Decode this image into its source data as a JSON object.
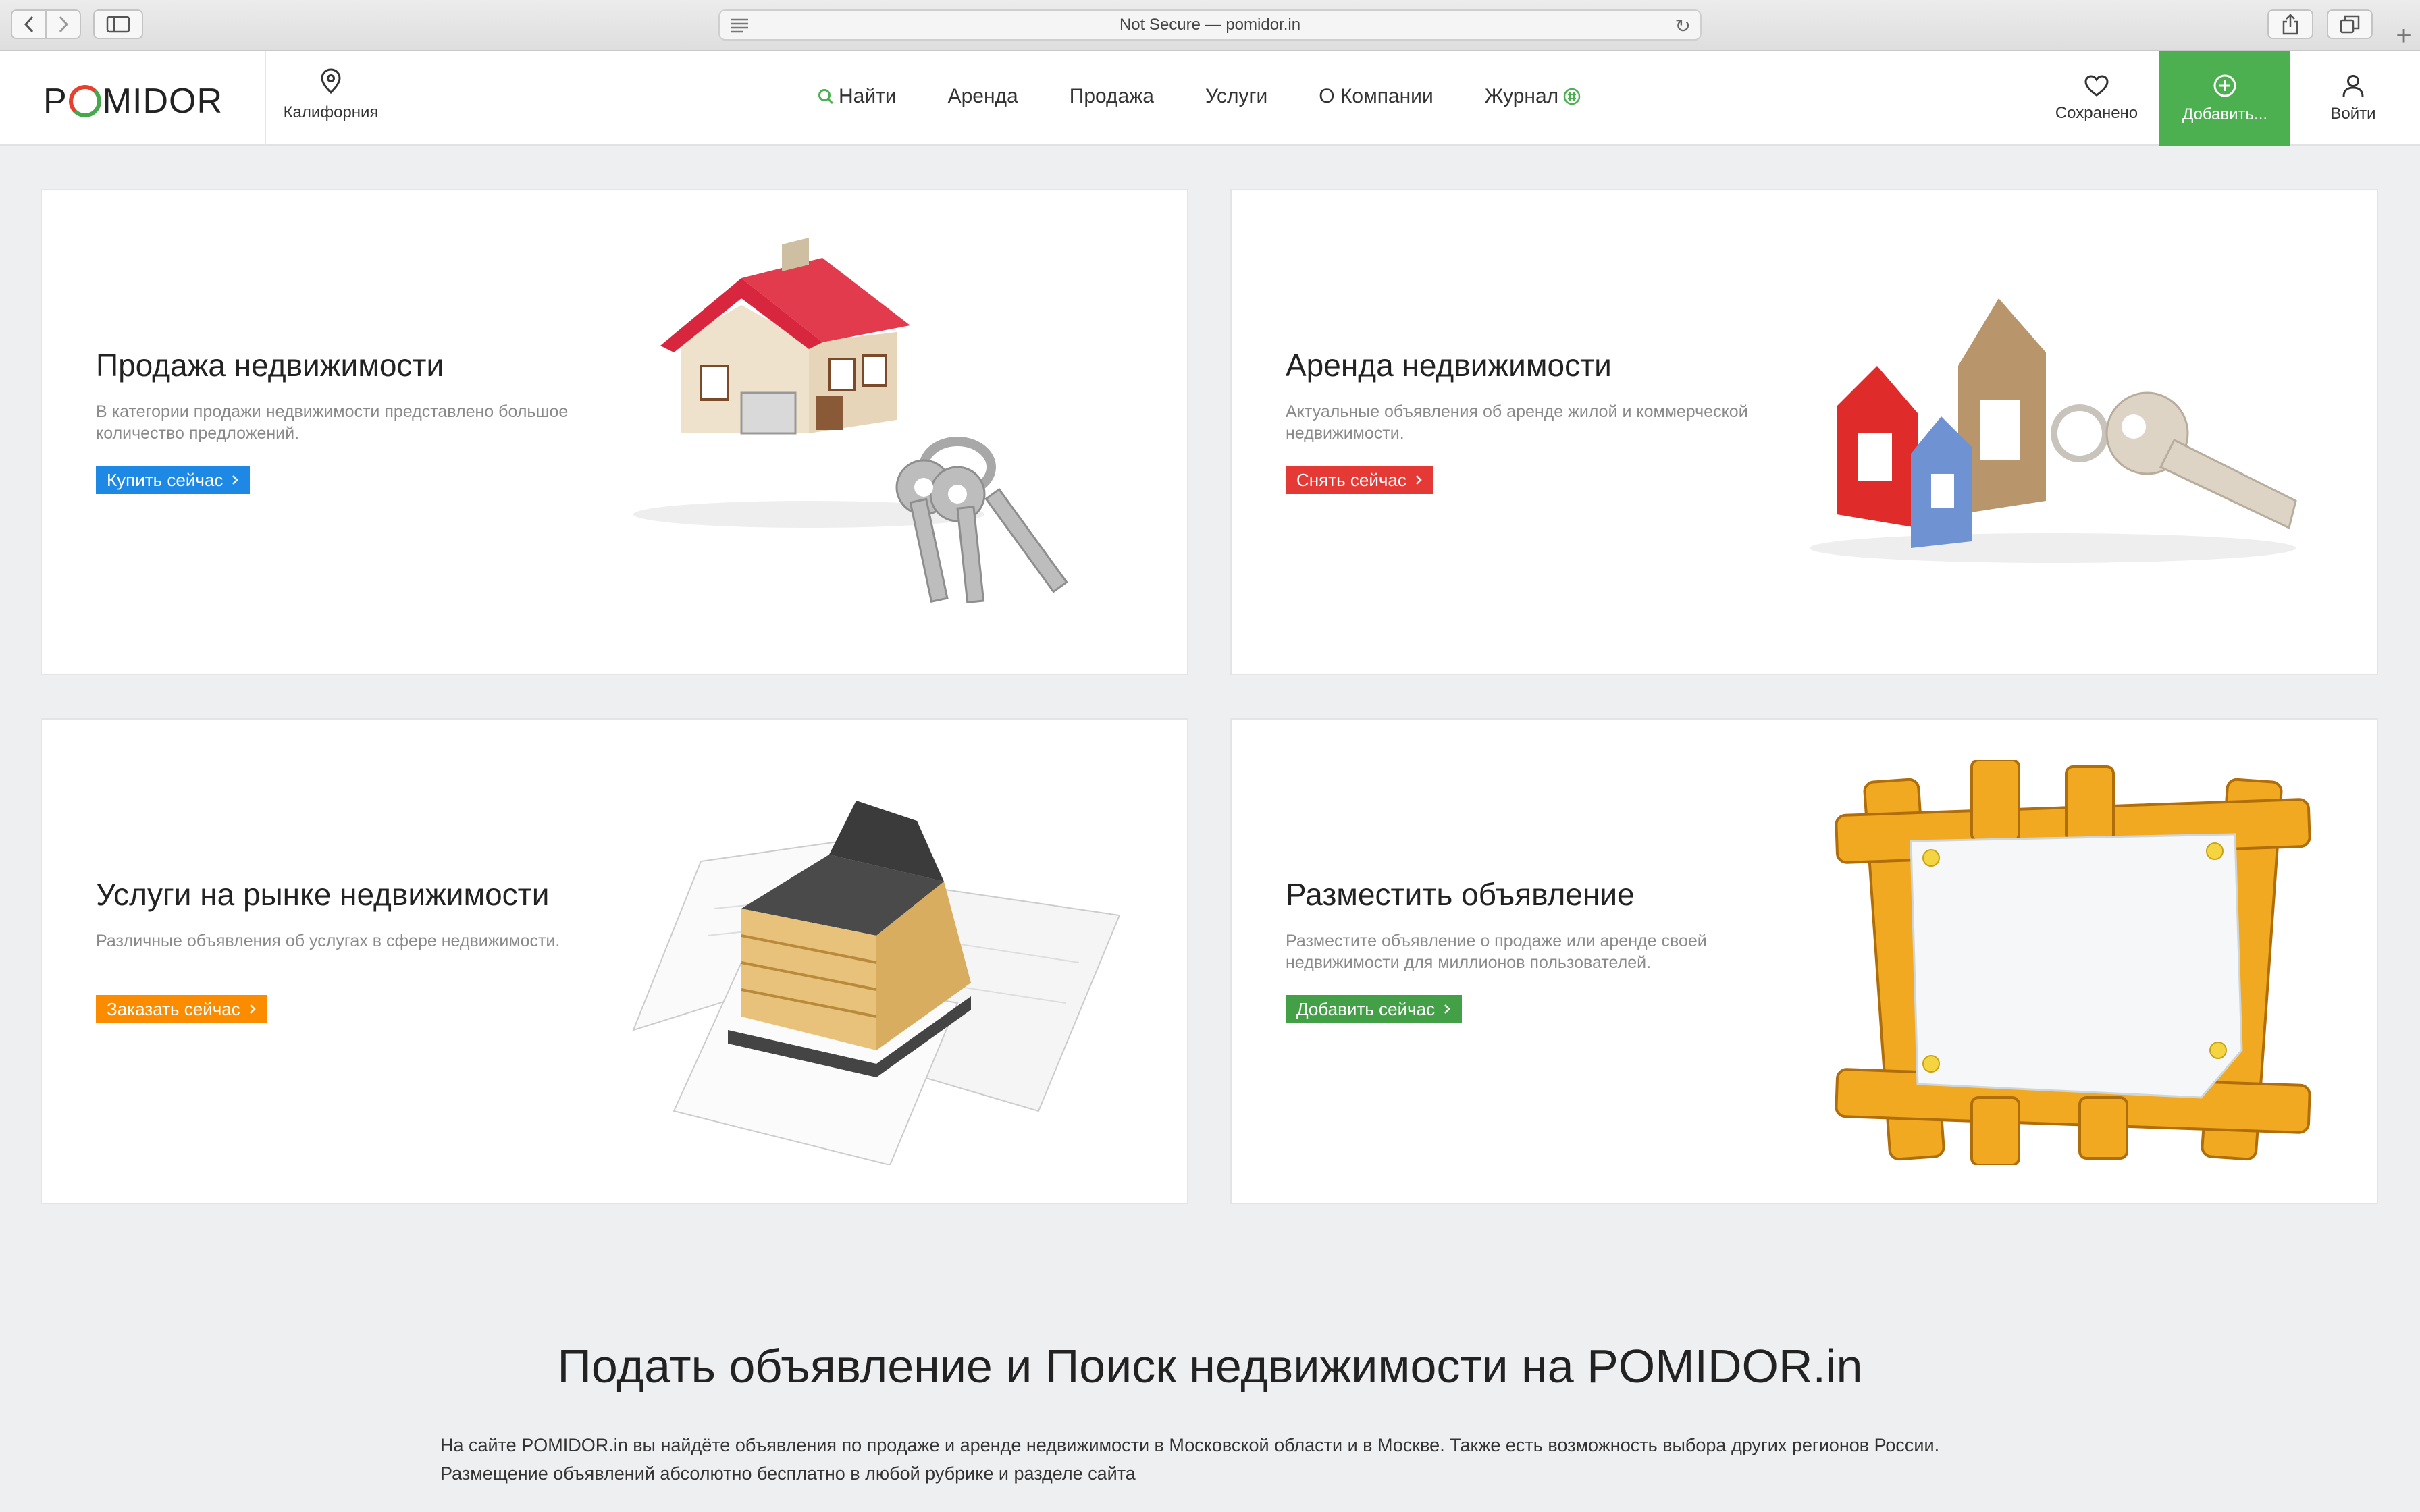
{
  "browser": {
    "address": "Not Secure — pomidor.in"
  },
  "header": {
    "logo_left": "P",
    "logo_right": "MIDOR",
    "location": "Калифорния",
    "nav": [
      {
        "label": "Найти"
      },
      {
        "label": "Аренда"
      },
      {
        "label": "Продажа"
      },
      {
        "label": "Услуги"
      },
      {
        "label": "О Компании"
      },
      {
        "label": "Журнал"
      }
    ],
    "saved": "Сохранено",
    "add": "Добавить...",
    "login": "Войти"
  },
  "cards": [
    {
      "title": "Продажа недвижимости",
      "desc": "В категории продажи недвижимости представлено большое количество предложений.",
      "button": "Купить сейчас"
    },
    {
      "title": "Аренда недвижимости",
      "desc": "Актуальные объявления об аренде жилой и коммерческой недвижимости.",
      "button": "Снять сейчас"
    },
    {
      "title": "Услуги на рынке недвижимости",
      "desc": "Различные объявления об услугах в сфере недвижимости.",
      "button": "Заказать сейчас"
    },
    {
      "title": "Разместить объявление",
      "desc": "Разместите объявление о продаже или аренде своей недвижимости для миллионов пользователей.",
      "button": "Добавить сейчас"
    }
  ],
  "bottom": {
    "title": "Подать объявление и Поиск недвижимости на POMIDOR.in",
    "text": "На сайте POMIDOR.in вы найдёте объявления по продаже и аренде недвижимости в Московской области и в Москве. Также есть возможность выбора других регионов России. Размещение объявлений абсолютно бесплатно в любой рубрике и разделе сайта"
  },
  "colors": {
    "accent_green": "#4caf50",
    "blue": "#1e88e5",
    "red": "#e53935",
    "orange": "#fb8c00",
    "green": "#43a047"
  },
  "icons": [
    "chevron-left-icon",
    "chevron-right-icon",
    "sidebar-icon",
    "reader-icon",
    "reload-icon",
    "share-icon",
    "tabs-icon",
    "plus-icon",
    "location-pin-icon",
    "search-icon",
    "journal-icon",
    "heart-icon",
    "plus-circle-icon",
    "user-icon",
    "chevron-right-icon"
  ]
}
